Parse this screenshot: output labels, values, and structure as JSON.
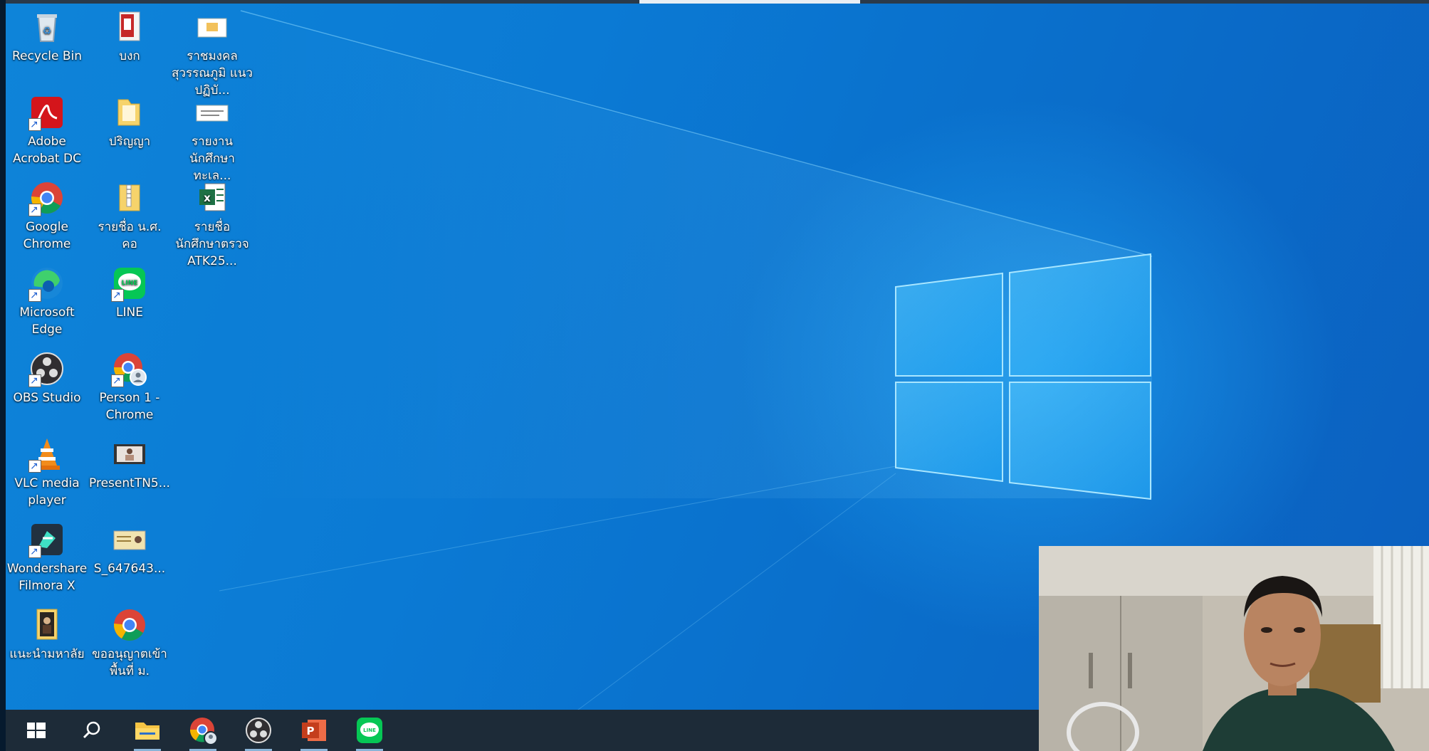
{
  "desktop_icons": [
    {
      "label": "Recycle Bin",
      "icon": "recycle-bin-icon"
    },
    {
      "label": "บงก",
      "icon": "pdf-document-icon"
    },
    {
      "label": "ราชมงคลสุวรรณภูมิ แนวปฏิบั...",
      "icon": "document-icon"
    },
    {
      "label": "Adobe Acrobat DC",
      "icon": "adobe-acrobat-icon"
    },
    {
      "label": "ปริญญา",
      "icon": "folder-icon"
    },
    {
      "label": "รายงานนักศึกษาทะเล...",
      "icon": "document-icon"
    },
    {
      "label": "Google Chrome",
      "icon": "chrome-icon"
    },
    {
      "label": "รายชื่อ น.ศ. คอ",
      "icon": "zip-folder-icon"
    },
    {
      "label": "รายชื่อนักศึกษาตรวจ ATK25...",
      "icon": "excel-icon"
    },
    {
      "label": "Microsoft Edge",
      "icon": "edge-icon"
    },
    {
      "label": "LINE",
      "icon": "line-icon"
    },
    {
      "label": "OBS Studio",
      "icon": "obs-icon"
    },
    {
      "label": "Person 1 - Chrome",
      "icon": "chrome-profile-icon"
    },
    {
      "label": "VLC media player",
      "icon": "vlc-icon"
    },
    {
      "label": "PresentTN5...",
      "icon": "video-file-icon"
    },
    {
      "label": "Wondershare Filmora X",
      "icon": "filmora-icon"
    },
    {
      "label": "S_647643...",
      "icon": "image-file-icon"
    },
    {
      "label": "แนะนำมหาลัย",
      "icon": "video-file-icon"
    },
    {
      "label": "ขออนุญาตเข้าพื้นที่ ม.",
      "icon": "chrome-icon"
    }
  ],
  "taskbar": {
    "items": [
      {
        "name": "start",
        "icon": "windows-start-icon"
      },
      {
        "name": "search",
        "icon": "search-icon"
      },
      {
        "name": "file-explorer",
        "icon": "folder-icon"
      },
      {
        "name": "chrome-person",
        "icon": "chrome-profile-icon"
      },
      {
        "name": "obs",
        "icon": "obs-icon"
      },
      {
        "name": "powerpoint",
        "icon": "powerpoint-icon"
      },
      {
        "name": "line",
        "icon": "line-icon"
      }
    ]
  },
  "colors": {
    "wallpaper": "#0b7ad4",
    "taskbar": "#1d2b38",
    "chrome_red": "#db4437",
    "chrome_yellow": "#f4b400",
    "chrome_green": "#0f9d58",
    "chrome_blue": "#4285f4",
    "line_green": "#06c755"
  },
  "webcam": {
    "content": "person-video-feed"
  }
}
